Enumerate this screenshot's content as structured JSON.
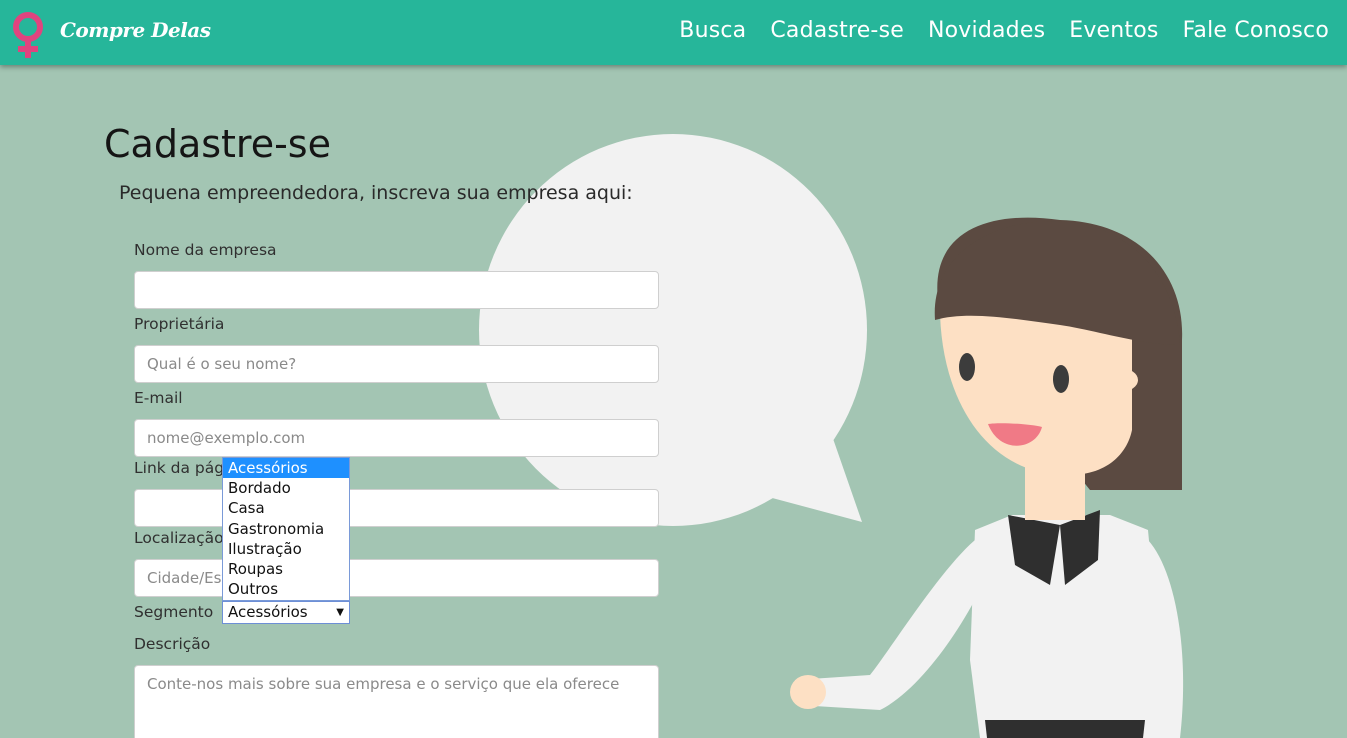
{
  "header": {
    "brand": "Compre Delas",
    "nav": [
      "Busca",
      "Cadastre-se",
      "Novidades",
      "Eventos",
      "Fale Conosco"
    ]
  },
  "form": {
    "title": "Cadastre-se",
    "subtitle": "Pequena empreendedora, inscreva sua empresa aqui:",
    "company_label": "Nome da empresa",
    "company_value": "",
    "owner_label": "Proprietária",
    "owner_placeholder": "Qual é o seu nome?",
    "email_label": "E-mail",
    "email_placeholder": "nome@exemplo.com",
    "link_label": "Link da página no Facebook",
    "link_value": "",
    "location_label": "Localização",
    "location_placeholder": "Cidade/Estado",
    "segment_label": "Segmento",
    "segment_selected": "Acessórios",
    "segment_options": [
      "Acessórios",
      "Bordado",
      "Casa",
      "Gastronomia",
      "Ilustração",
      "Roupas",
      "Outros"
    ],
    "description_label": "Descrição",
    "description_placeholder": "Conte-nos mais sobre sua empresa e o serviço que ela oferece"
  },
  "icons": {
    "logo": "female-symbol-icon",
    "select_arrow": "caret-down-icon"
  },
  "colors": {
    "navbar": "#26b69a",
    "background": "#a3c5b3",
    "logo": "#e0447f",
    "option_highlight": "#1e90ff"
  }
}
